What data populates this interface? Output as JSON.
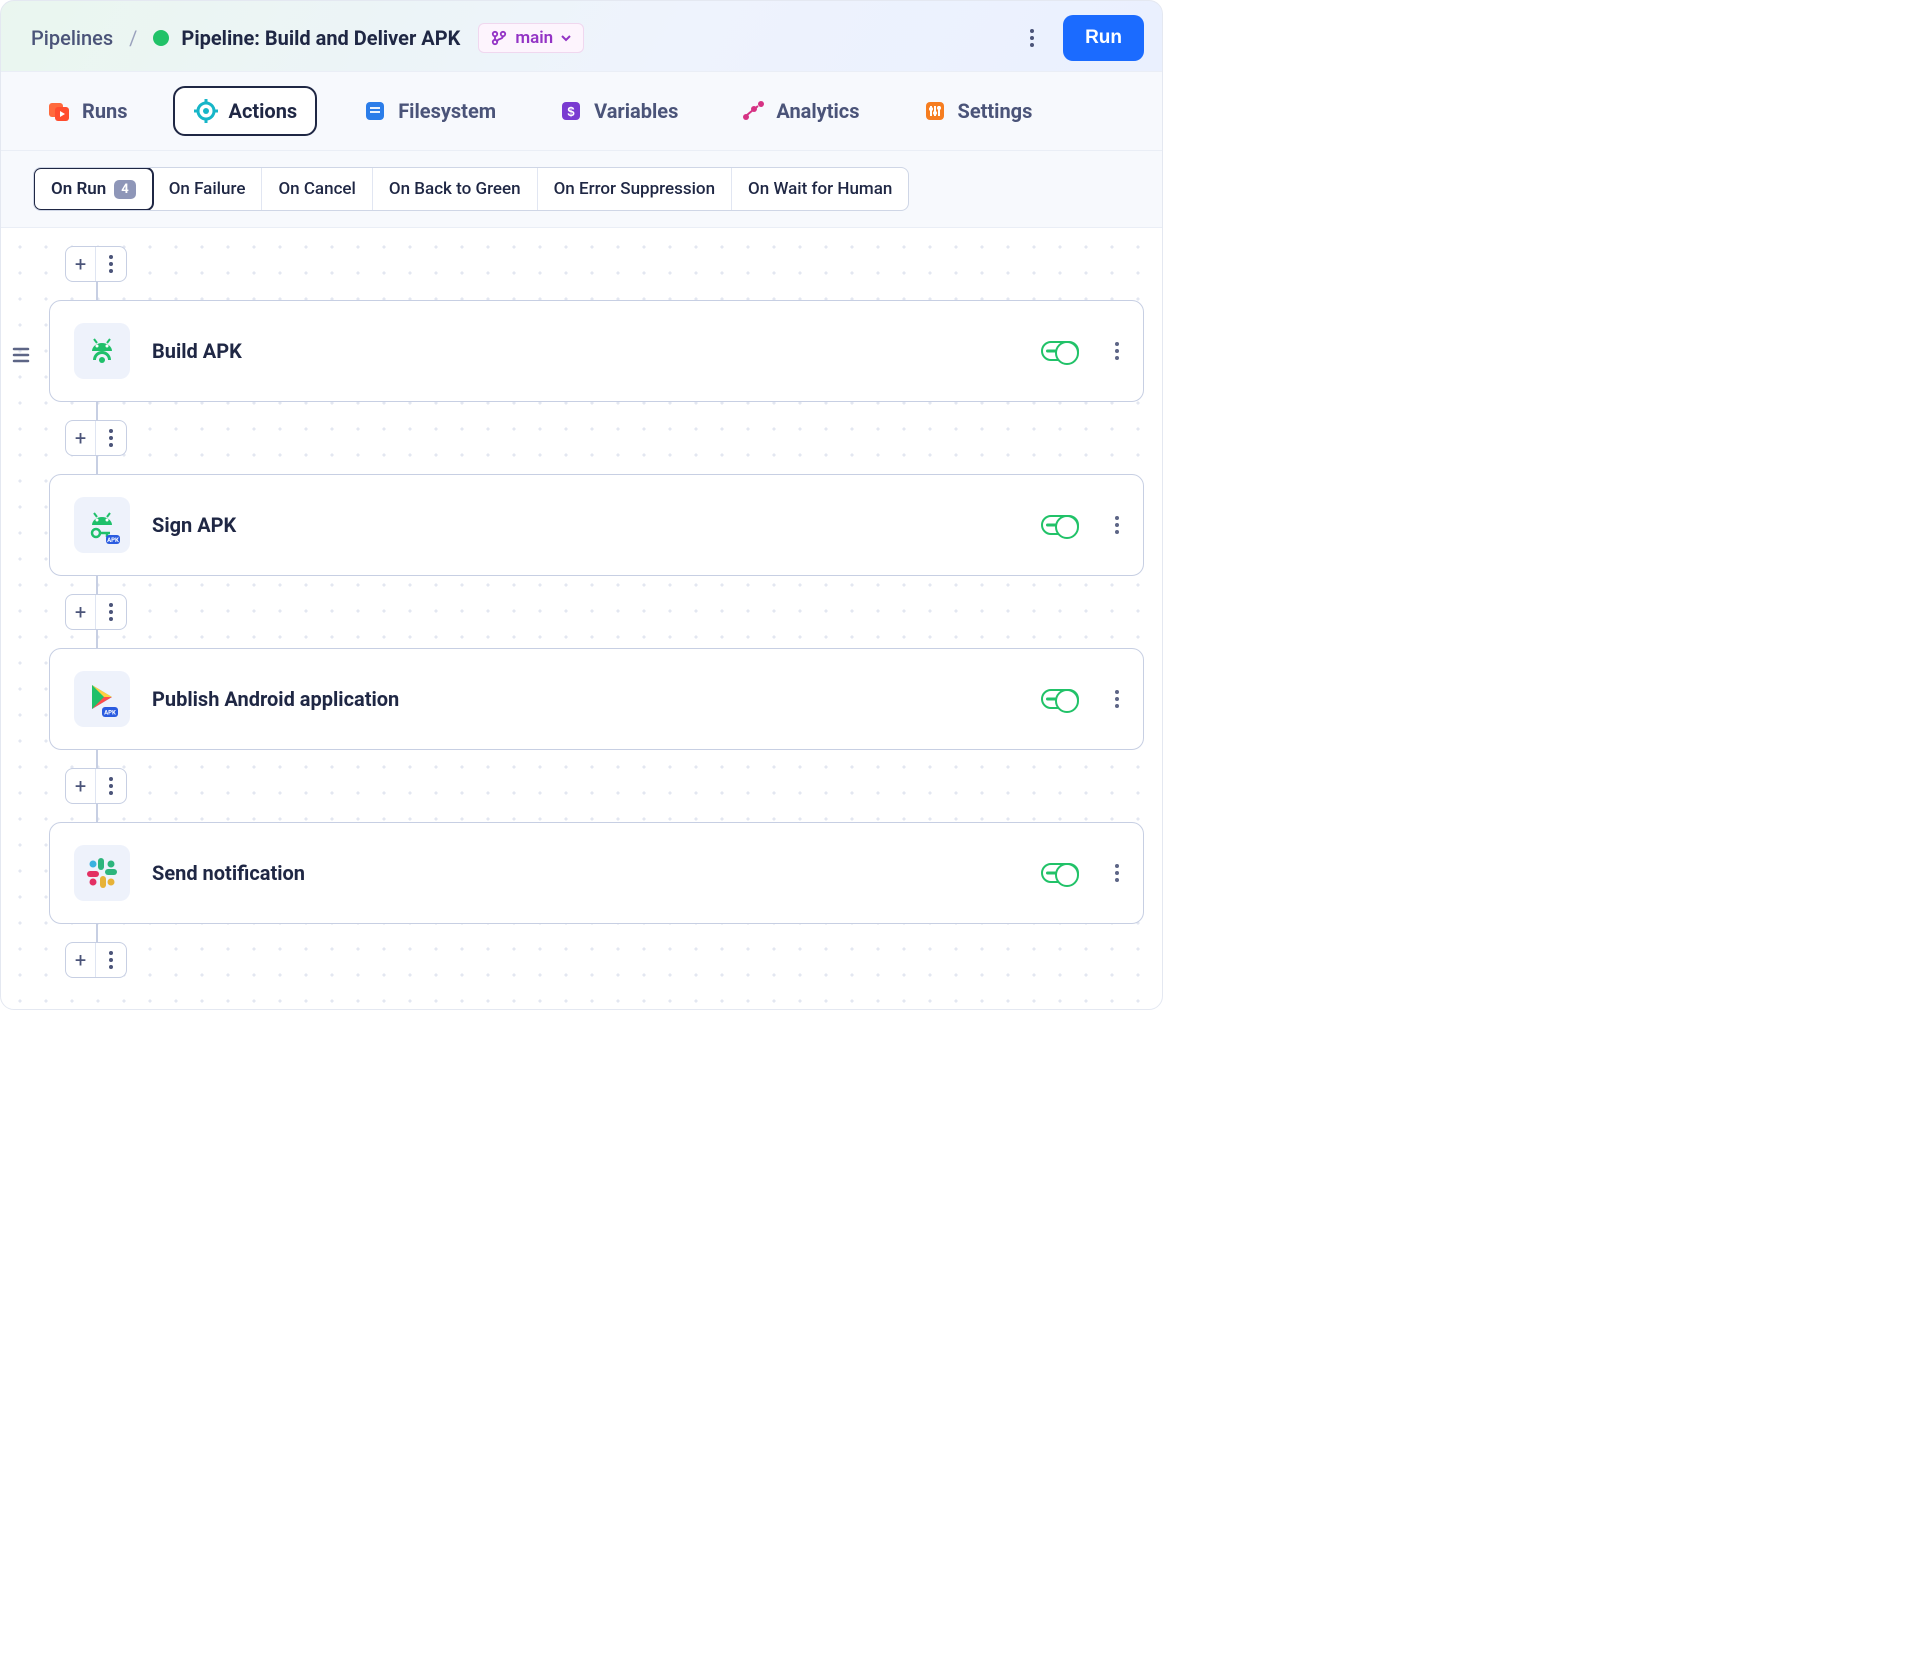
{
  "breadcrumb": {
    "root": "Pipelines",
    "title": "Pipeline: Build and Deliver APK"
  },
  "branch": {
    "label": "main"
  },
  "header": {
    "run": "Run"
  },
  "tabs": [
    {
      "id": "runs",
      "label": "Runs",
      "color": "#ff4d2e"
    },
    {
      "id": "actions",
      "label": "Actions",
      "color": "#17b6c8",
      "active": true
    },
    {
      "id": "filesystem",
      "label": "Filesystem",
      "color": "#2b7de9"
    },
    {
      "id": "variables",
      "label": "Variables",
      "color": "#7a3bd1"
    },
    {
      "id": "analytics",
      "label": "Analytics",
      "color": "#d63384"
    },
    {
      "id": "settings",
      "label": "Settings",
      "color": "#f67d20"
    }
  ],
  "triggers": [
    {
      "id": "on-run",
      "label": "On Run",
      "count": "4",
      "active": true
    },
    {
      "id": "on-failure",
      "label": "On Failure"
    },
    {
      "id": "on-cancel",
      "label": "On Cancel"
    },
    {
      "id": "on-back-to-green",
      "label": "On Back to Green"
    },
    {
      "id": "on-error-suppression",
      "label": "On Error Suppression"
    },
    {
      "id": "on-wait-for-human",
      "label": "On Wait for Human"
    }
  ],
  "actions": [
    {
      "id": "build-apk",
      "label": "Build APK",
      "icon": "android-build",
      "enabled": true
    },
    {
      "id": "sign-apk",
      "label": "Sign APK",
      "icon": "android-sign",
      "enabled": true
    },
    {
      "id": "publish-android",
      "label": "Publish Android application",
      "icon": "play-store",
      "enabled": true
    },
    {
      "id": "send-notification",
      "label": "Send notification",
      "icon": "slack",
      "enabled": true
    }
  ]
}
